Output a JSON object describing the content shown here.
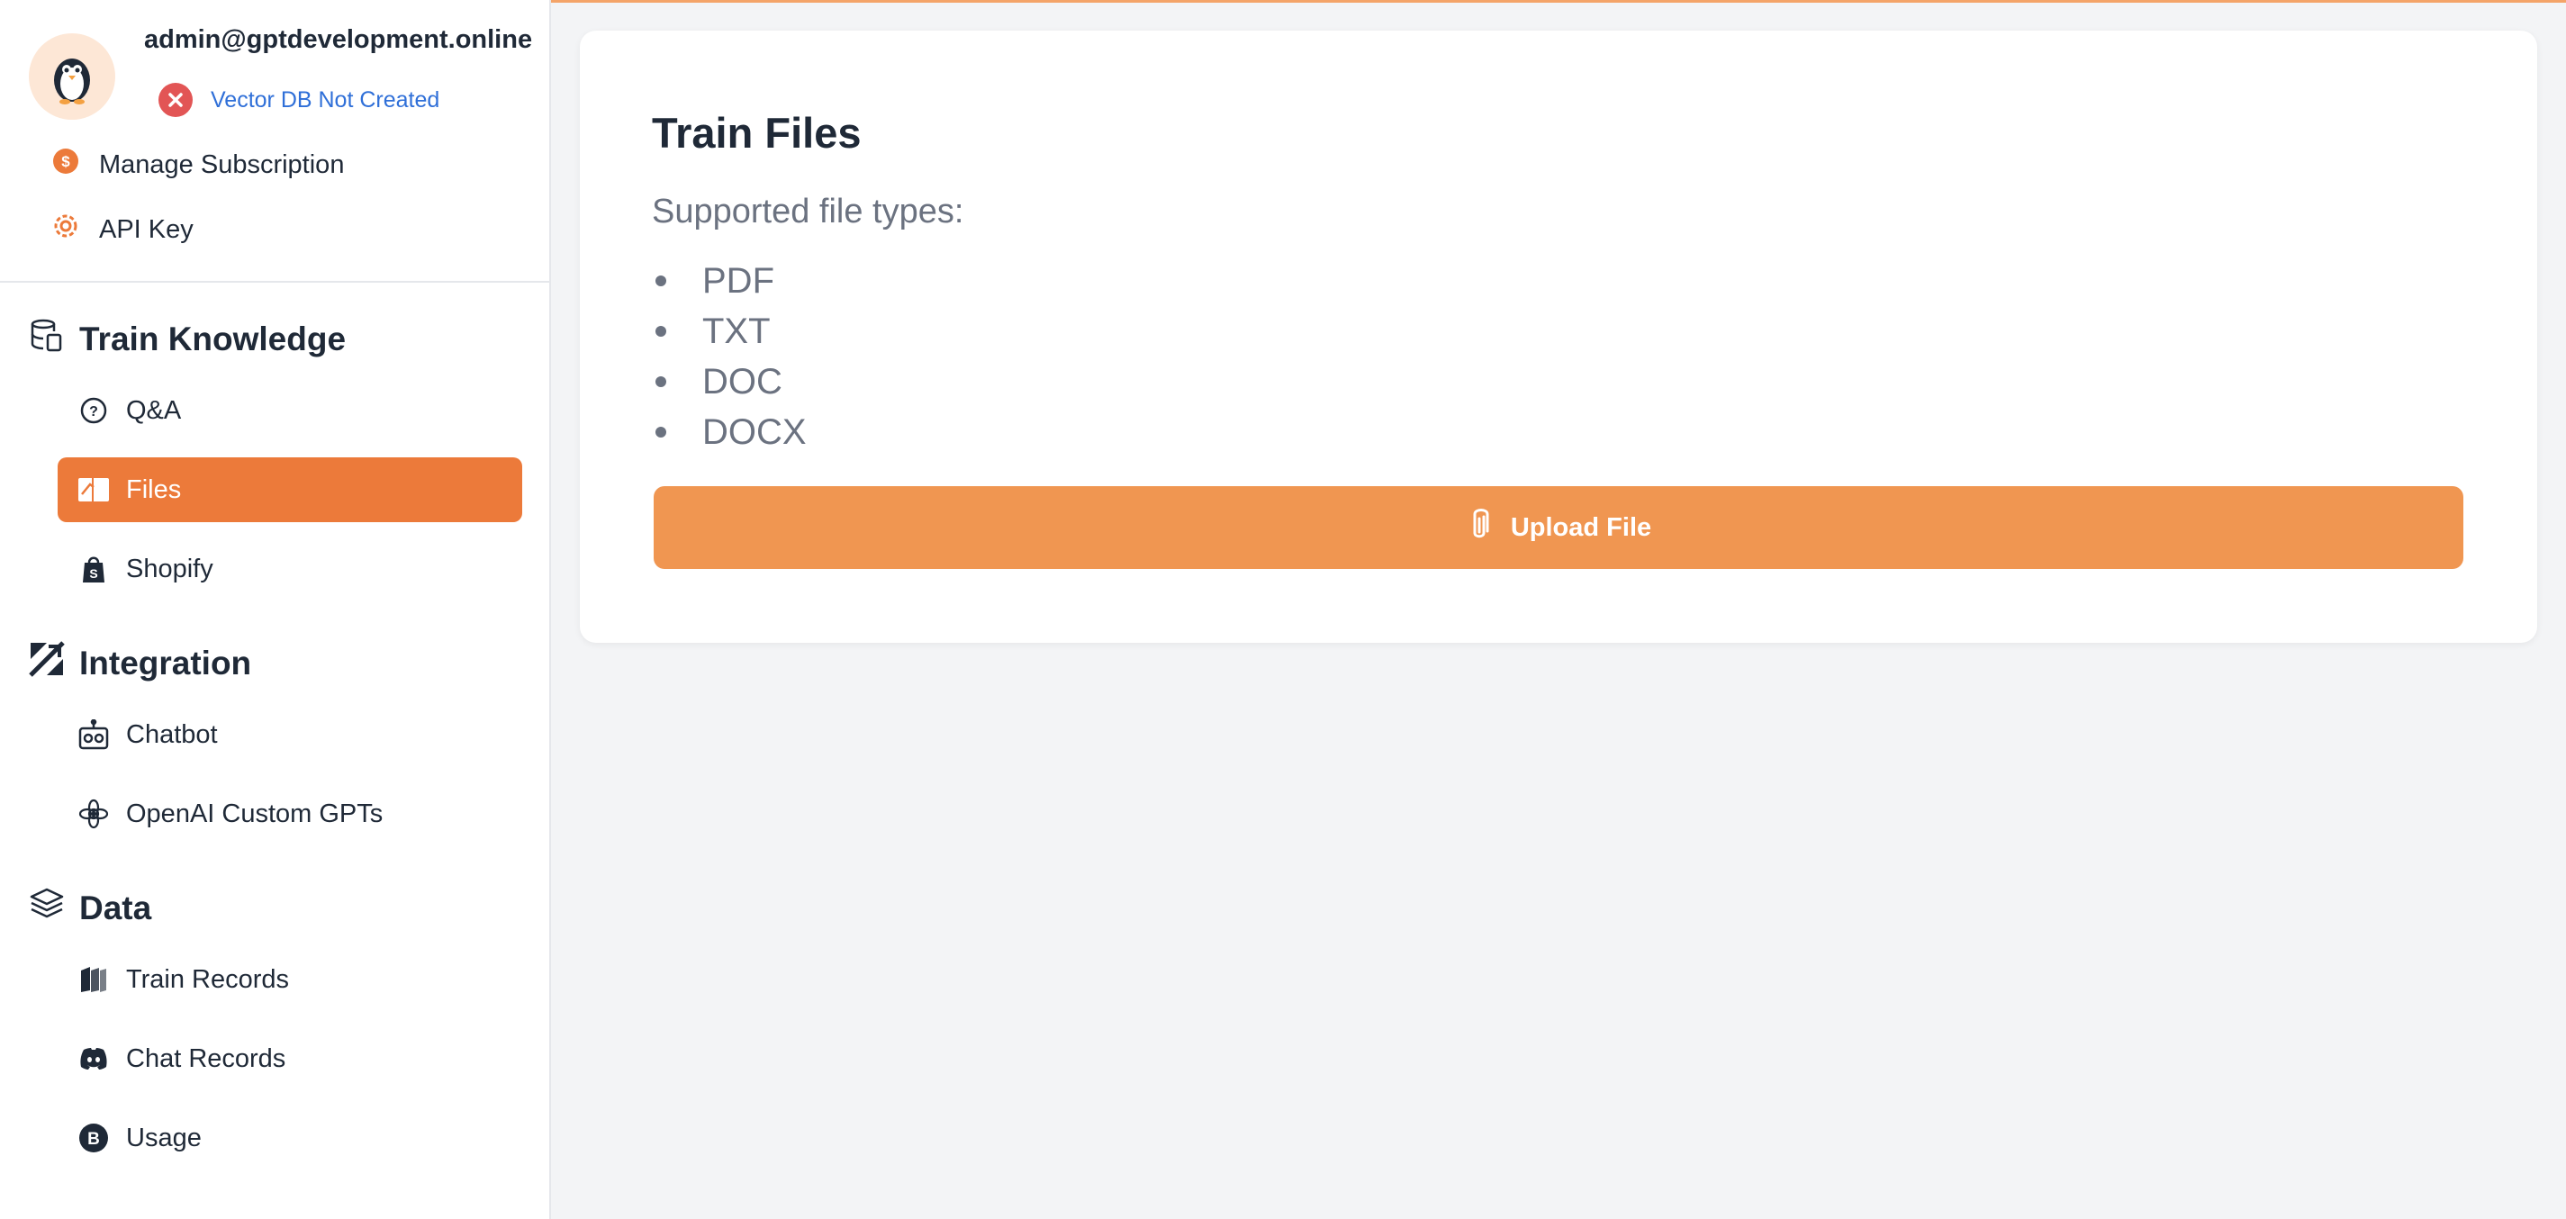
{
  "account": {
    "email": "admin@gptdevelopment.online",
    "vector_db_status": "Vector DB Not Created"
  },
  "top_links": {
    "subscription": "Manage Subscription",
    "api_key": "API Key"
  },
  "sections": {
    "train_knowledge": {
      "title": "Train Knowledge",
      "items": [
        "Q&A",
        "Files",
        "Shopify"
      ]
    },
    "integration": {
      "title": "Integration",
      "items": [
        "Chatbot",
        "OpenAI Custom GPTs"
      ]
    },
    "data": {
      "title": "Data",
      "items": [
        "Train Records",
        "Chat Records",
        "Usage"
      ]
    }
  },
  "active_item": "Files",
  "main": {
    "title": "Train Files",
    "subtitle": "Supported file types:",
    "file_types": [
      "PDF",
      "TXT",
      "DOC",
      "DOCX"
    ],
    "upload_label": "Upload File"
  },
  "colors": {
    "accent": "#ec7a3a",
    "upload_button": "#f09651",
    "error": "#e25555",
    "link": "#2f6fd8"
  }
}
